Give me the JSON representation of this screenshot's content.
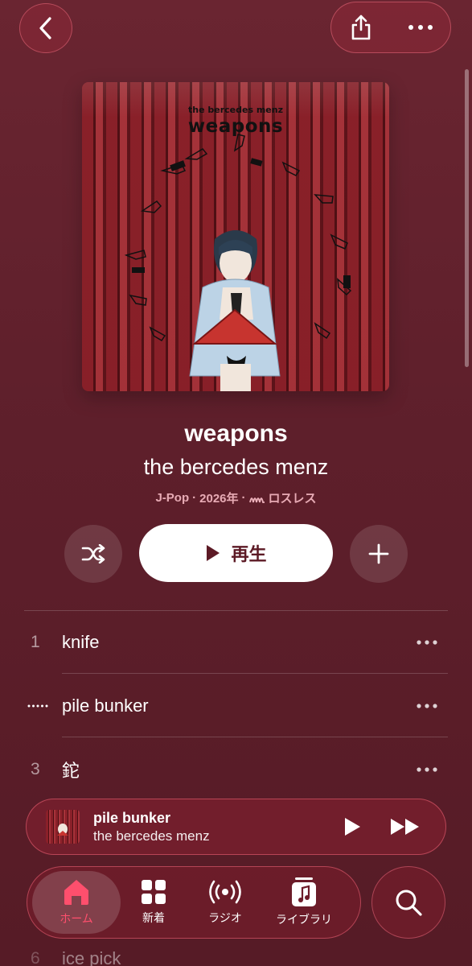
{
  "header": {
    "back_icon": "chevron-left-icon",
    "share_icon": "share-icon",
    "more_icon": "ellipsis-icon"
  },
  "artwork": {
    "small_title": "the bercedes menz",
    "big_title": "weapons"
  },
  "album": {
    "title": "weapons",
    "artist": "the bercedes menz",
    "genre": "J-Pop",
    "year": "2026年",
    "quality_icon": "lossless-icon",
    "quality": "ロスレス"
  },
  "actions": {
    "shuffle_icon": "shuffle-icon",
    "play_label": "再生",
    "add_icon": "plus-icon"
  },
  "tracks": [
    {
      "number": "1",
      "title": "knife",
      "playing": false
    },
    {
      "number": "",
      "title": "pile bunker",
      "playing": true
    },
    {
      "number": "3",
      "title": "鉈",
      "playing": false
    }
  ],
  "peek_track": {
    "number": "6",
    "title": "ice pick"
  },
  "now_playing": {
    "title": "pile bunker",
    "artist": "the bercedes menz",
    "play_icon": "play-icon",
    "forward_icon": "fast-forward-icon"
  },
  "tabbar": {
    "tabs": [
      {
        "label": "ホーム",
        "icon": "home-icon",
        "active": true
      },
      {
        "label": "新着",
        "icon": "grid-icon",
        "active": false
      },
      {
        "label": "ラジオ",
        "icon": "radio-icon",
        "active": false
      },
      {
        "label": "ライブラリ",
        "icon": "music-library-icon",
        "active": false
      }
    ],
    "search_icon": "search-icon"
  },
  "colors": {
    "accent": "#ff4f6d",
    "background": "#5e1f2b"
  }
}
